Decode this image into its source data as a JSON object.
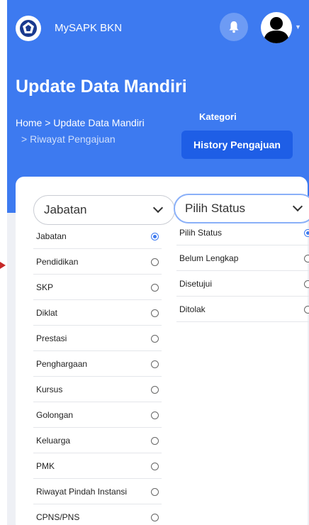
{
  "app": {
    "name": "MySAPK BKN"
  },
  "page": {
    "title": "Update Data Mandiri"
  },
  "breadcrumb": {
    "line1": "Home  >  Update Data Mandiri",
    "line2": ">  Riwayat Pengajuan"
  },
  "kategori": {
    "label": "Kategori",
    "button": "History Pengajuan"
  },
  "filters": {
    "jabatan_select": "Jabatan",
    "status_select": "Pilih Status"
  },
  "jabatan_list": [
    {
      "label": "Jabatan",
      "checked": true
    },
    {
      "label": "Pendidikan",
      "checked": false
    },
    {
      "label": "SKP",
      "checked": false
    },
    {
      "label": "Diklat",
      "checked": false
    },
    {
      "label": "Prestasi",
      "checked": false
    },
    {
      "label": "Penghargaan",
      "checked": false
    },
    {
      "label": "Kursus",
      "checked": false
    },
    {
      "label": "Golongan",
      "checked": false
    },
    {
      "label": "Keluarga",
      "checked": false
    },
    {
      "label": "PMK",
      "checked": false
    },
    {
      "label": "Riwayat Pindah Instansi",
      "checked": false
    },
    {
      "label": "CPNS/PNS",
      "checked": false
    }
  ],
  "status_list": [
    {
      "label": "Pilih Status",
      "checked": true
    },
    {
      "label": "Belum Lengkap",
      "checked": false
    },
    {
      "label": "Disetujui",
      "checked": false
    },
    {
      "label": "Ditolak",
      "checked": false
    }
  ],
  "colors": {
    "primary": "#3d7af0",
    "button": "#1e5ee6"
  }
}
